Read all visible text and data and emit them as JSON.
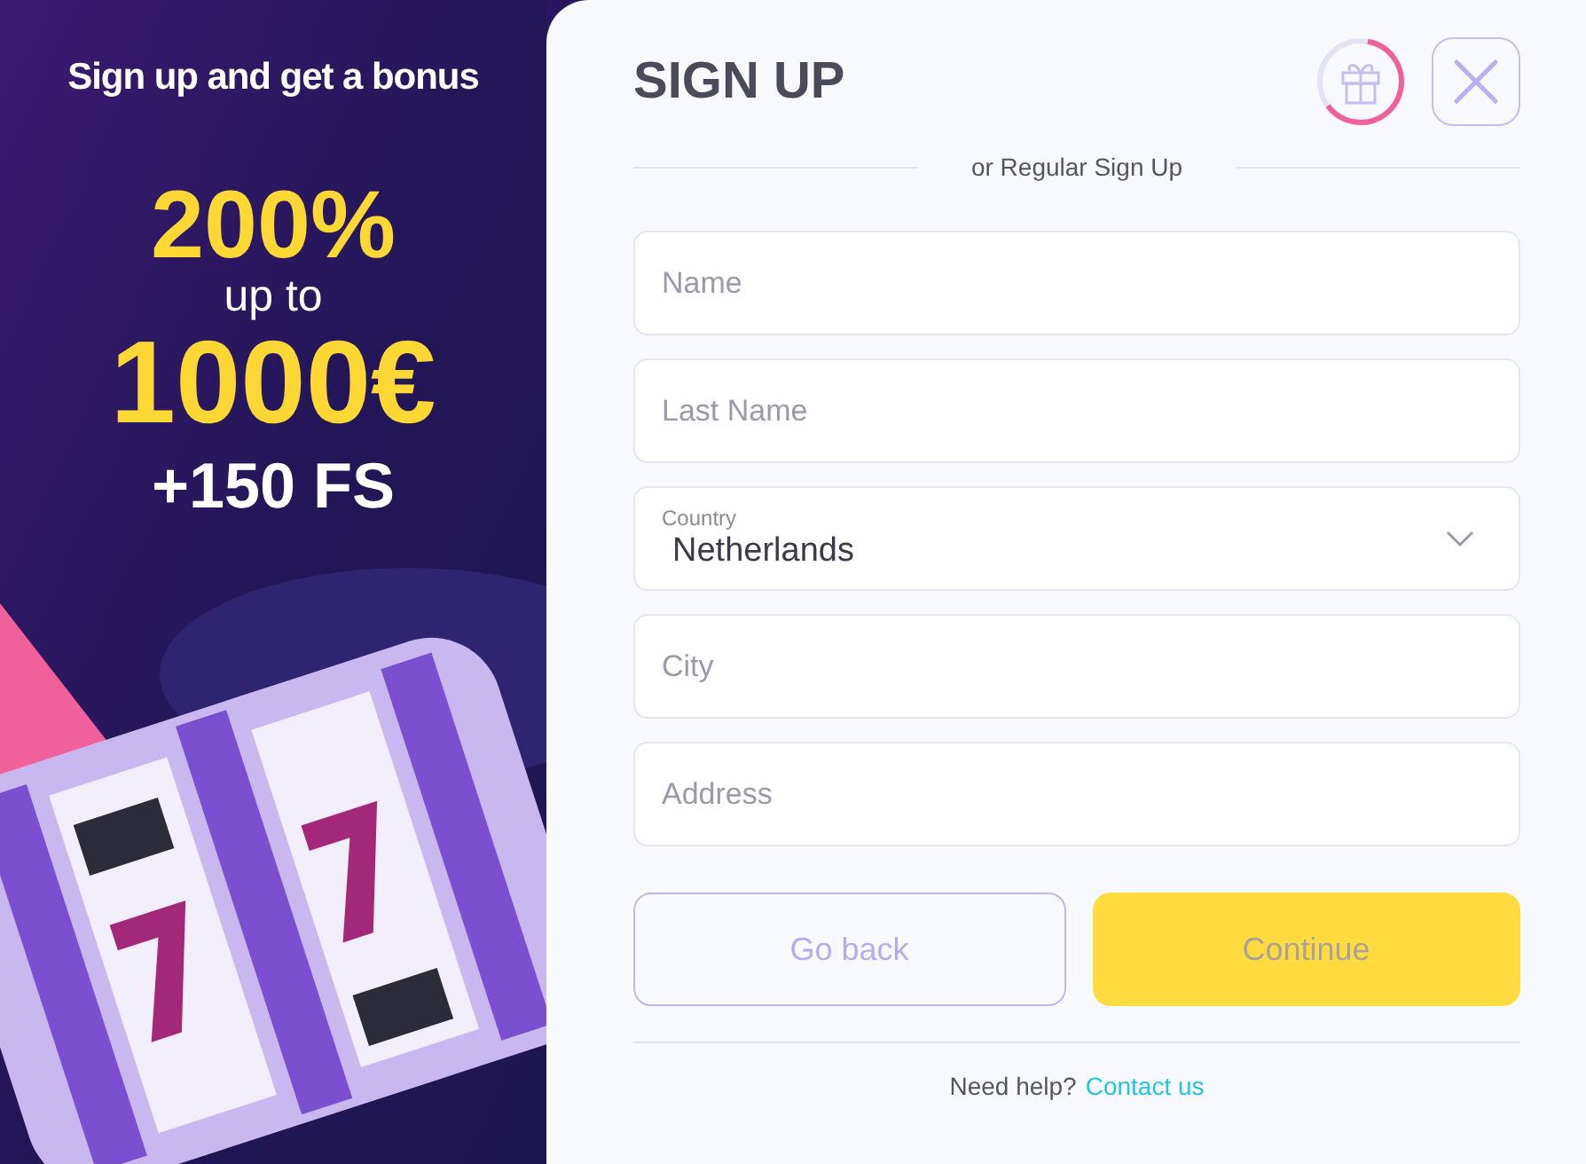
{
  "promo": {
    "heading": "Sign up and get a bonus",
    "percent": "200%",
    "up_to": "up to",
    "amount": "1000€",
    "free_spins": "+150 FS"
  },
  "form": {
    "title": "SIGN UP",
    "bonus_progress": {
      "level": 0.62
    },
    "divider_text": "or Regular Sign Up",
    "fields": [
      {
        "kind": "text",
        "placeholder": "Name"
      },
      {
        "kind": "text",
        "placeholder": "Last Name"
      },
      {
        "kind": "select",
        "label": "Country",
        "value": "Netherlands"
      },
      {
        "kind": "text",
        "placeholder": "City"
      },
      {
        "kind": "text",
        "placeholder": "Address"
      }
    ],
    "buttons": [
      {
        "kind": "secondary",
        "label": "Go back",
        "disabled": false
      },
      {
        "kind": "primary",
        "label": "Continue",
        "disabled": true
      }
    ],
    "help": {
      "text": "Need help?",
      "link": "Contact us"
    }
  }
}
